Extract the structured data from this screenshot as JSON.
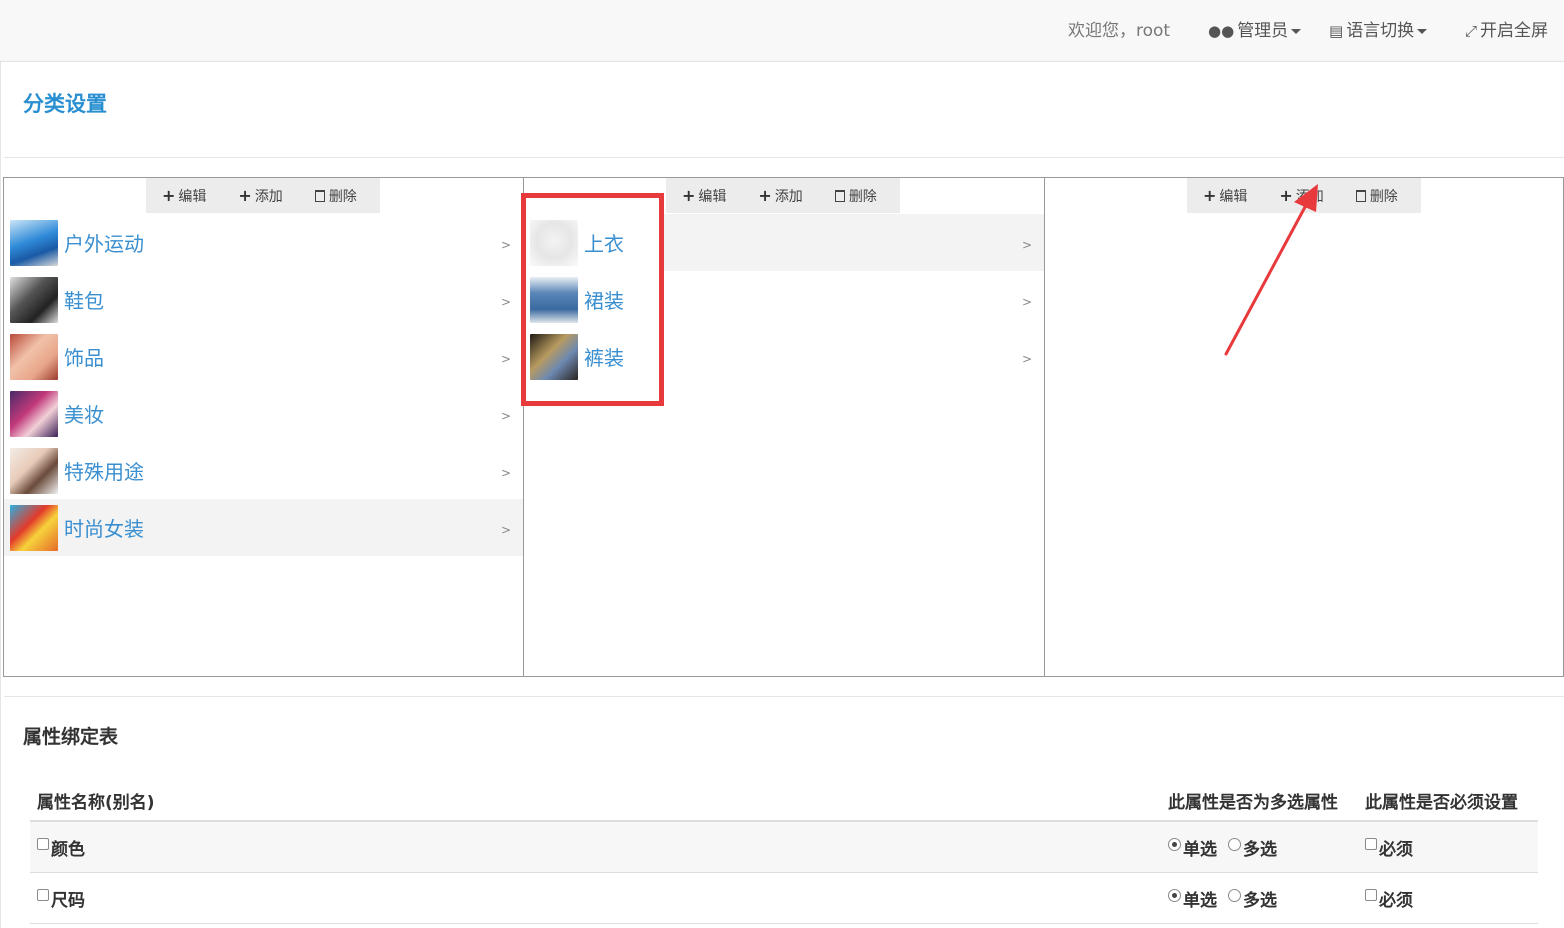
{
  "header": {
    "welcome": "欢迎您，root",
    "admin_label": "管理员",
    "language_label": "语言切换",
    "fullscreen_label": "开启全屏"
  },
  "page_title": "分类设置",
  "toolbar": {
    "edit_label": "编辑",
    "add_label": "添加",
    "delete_label": "删除"
  },
  "columns": [
    {
      "items": [
        {
          "label": "户外运动",
          "active": false
        },
        {
          "label": "鞋包",
          "active": false
        },
        {
          "label": "饰品",
          "active": false
        },
        {
          "label": "美妆",
          "active": false
        },
        {
          "label": "特殊用途",
          "active": false
        },
        {
          "label": "时尚女装",
          "active": true
        }
      ]
    },
    {
      "items": [
        {
          "label": "上衣",
          "active": true
        },
        {
          "label": "裙装",
          "active": false
        },
        {
          "label": "裤装",
          "active": false
        }
      ]
    },
    {
      "items": []
    }
  ],
  "chevron": ">",
  "attr_section_title": "属性绑定表",
  "attr_table": {
    "headers": {
      "name": "属性名称(别名)",
      "multi": "此属性是否为多选属性",
      "required": "此属性是否必须设置"
    },
    "rows": [
      {
        "name": "颜色",
        "single_label": "单选",
        "multi_label": "多选",
        "required_label": "必须",
        "selected": "single"
      },
      {
        "name": "尺码",
        "single_label": "单选",
        "multi_label": "多选",
        "required_label": "必须",
        "selected": "single"
      }
    ]
  },
  "icons": {
    "admin": "users-icon",
    "language": "book-icon",
    "fullscreen": "expand-icon",
    "edit": "plus-icon",
    "add": "plus-icon",
    "delete": "trash-icon"
  },
  "colors": {
    "accent": "#2a8fd0",
    "highlight": "#e8393d"
  }
}
